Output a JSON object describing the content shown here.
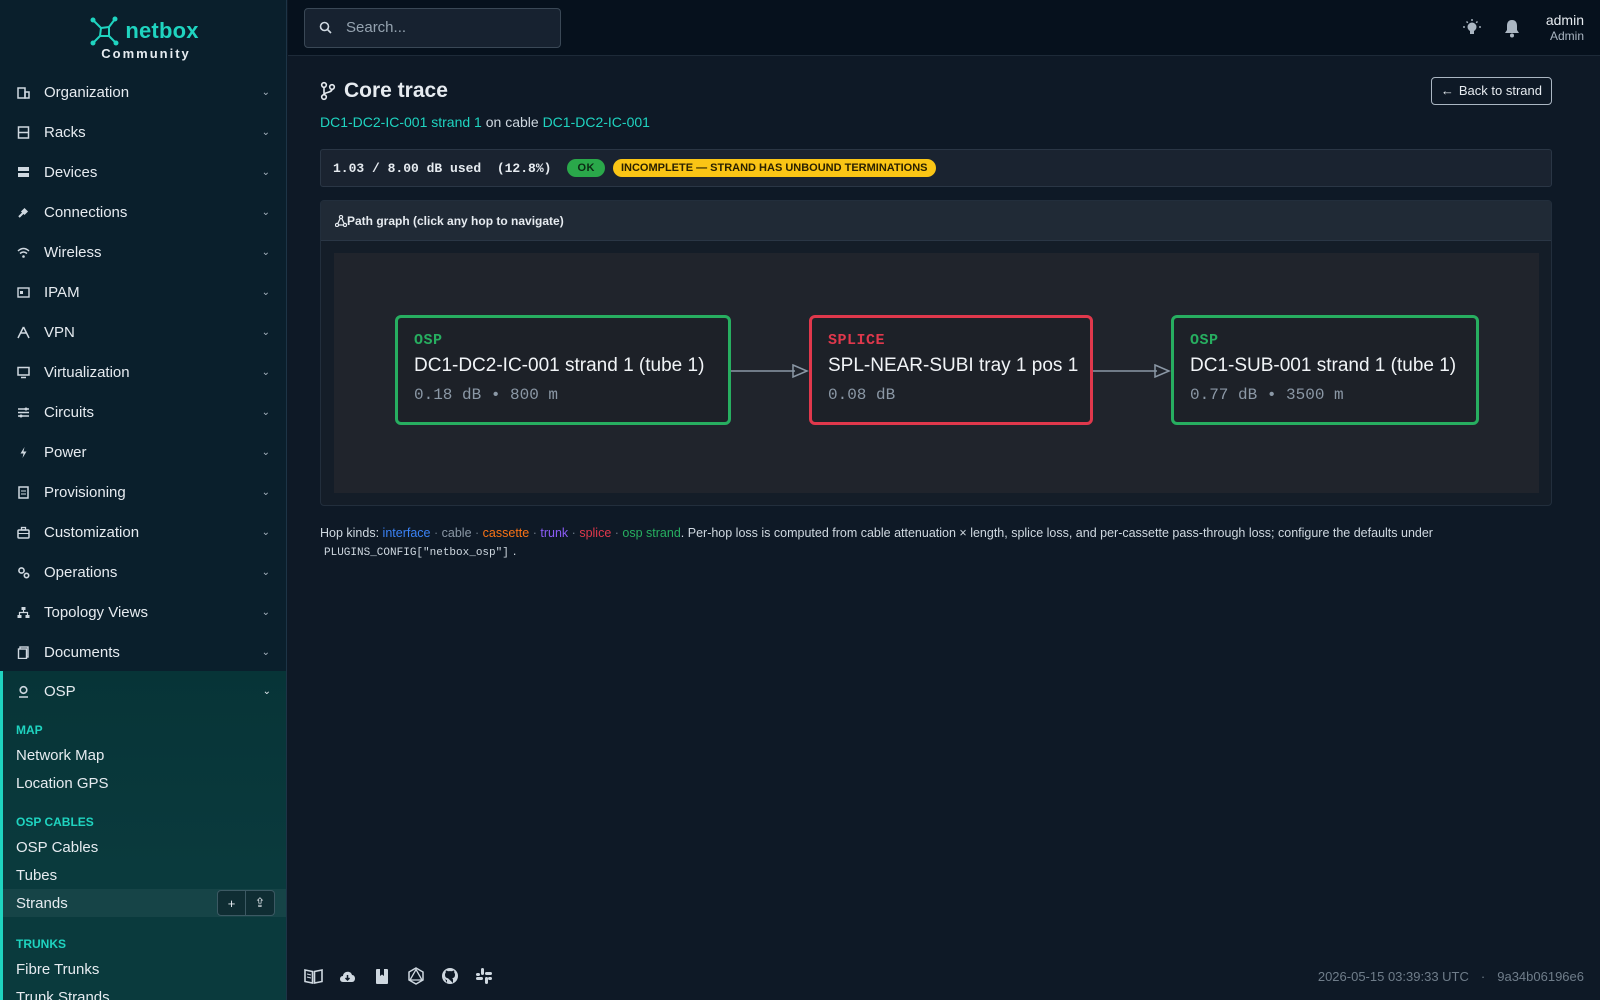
{
  "brand": {
    "name": "netbox",
    "edition": "Community"
  },
  "sidebar": {
    "items": [
      {
        "label": "Organization",
        "icon": "building-icon"
      },
      {
        "label": "Racks",
        "icon": "rack-icon"
      },
      {
        "label": "Devices",
        "icon": "server-icon"
      },
      {
        "label": "Connections",
        "icon": "plug-icon"
      },
      {
        "label": "Wireless",
        "icon": "wifi-icon"
      },
      {
        "label": "IPAM",
        "icon": "counter-icon"
      },
      {
        "label": "VPN",
        "icon": "tunnel-icon"
      },
      {
        "label": "Virtualization",
        "icon": "monitor-icon"
      },
      {
        "label": "Circuits",
        "icon": "transit-icon"
      },
      {
        "label": "Power",
        "icon": "flash-icon"
      },
      {
        "label": "Provisioning",
        "icon": "file-icon"
      },
      {
        "label": "Customization",
        "icon": "toolbox-icon"
      },
      {
        "label": "Operations",
        "icon": "cogs-icon"
      },
      {
        "label": "Topology Views",
        "icon": "sitemap-icon"
      },
      {
        "label": "Documents",
        "icon": "document-icon"
      }
    ],
    "osp": {
      "label": "OSP",
      "groups": [
        {
          "heading": "MAP",
          "items": [
            "Network Map",
            "Location GPS"
          ]
        },
        {
          "heading": "OSP CABLES",
          "items": [
            "OSP Cables",
            "Tubes",
            "Strands"
          ]
        },
        {
          "heading": "TRUNKS",
          "items": [
            "Fibre Trunks",
            "Trunk Strands"
          ]
        }
      ],
      "active_item": "Strands",
      "add_glyph": "+",
      "import_glyph": "⇪"
    }
  },
  "topbar": {
    "search_placeholder": "Search...",
    "user_name": "admin",
    "user_role": "Admin"
  },
  "page": {
    "title": "Core trace",
    "back_label": "Back to strand",
    "back_glyph": "←",
    "subtitle_link1": "DC1-DC2-IC-001 strand 1",
    "subtitle_mid": "on cable",
    "subtitle_link2": "DC1-DC2-IC-001",
    "budget_text": "1.03 / 8.00 dB used  (12.8%)",
    "status_ok": "OK",
    "status_warning": "INCOMPLETE — STRAND HAS UNBOUND TERMINATIONS",
    "graph_title": "Path graph (click any hop to navigate)",
    "hops": [
      {
        "kind": "OSP",
        "name": "DC1-DC2-IC-001 strand 1 (tube 1)",
        "meta": "0.18 dB • 800 m"
      },
      {
        "kind": "SPLICE",
        "name": "SPL-NEAR-SUBI tray 1 pos 1",
        "meta": "0.08 dB"
      },
      {
        "kind": "OSP",
        "name": "DC1-SUB-001 strand 1 (tube 1)",
        "meta": "0.77 dB • 3500 m"
      }
    ],
    "legend": {
      "prefix": "Hop kinds:",
      "interface": "interface",
      "cable": "cable",
      "cassette": "cassette",
      "trunk": "trunk",
      "splice": "splice",
      "osp": "osp strand",
      "separator": "·",
      "text": ". Per-hop loss is computed from cable attenuation × length, splice loss, and per-cassette pass-through loss; configure the defaults under",
      "code": "PLUGINS_CONFIG[\"netbox_osp\"]",
      "suffix": "."
    }
  },
  "footer": {
    "timestamp": "2026-05-15 03:39:33 UTC",
    "separator": "·",
    "commit": "9a34b06196e6"
  },
  "colors": {
    "accent": "#1fd4c0",
    "ok": "#2aa84a",
    "warning": "#fac515",
    "osp_hop": "#27ae60",
    "splice_hop": "#e0384c"
  }
}
